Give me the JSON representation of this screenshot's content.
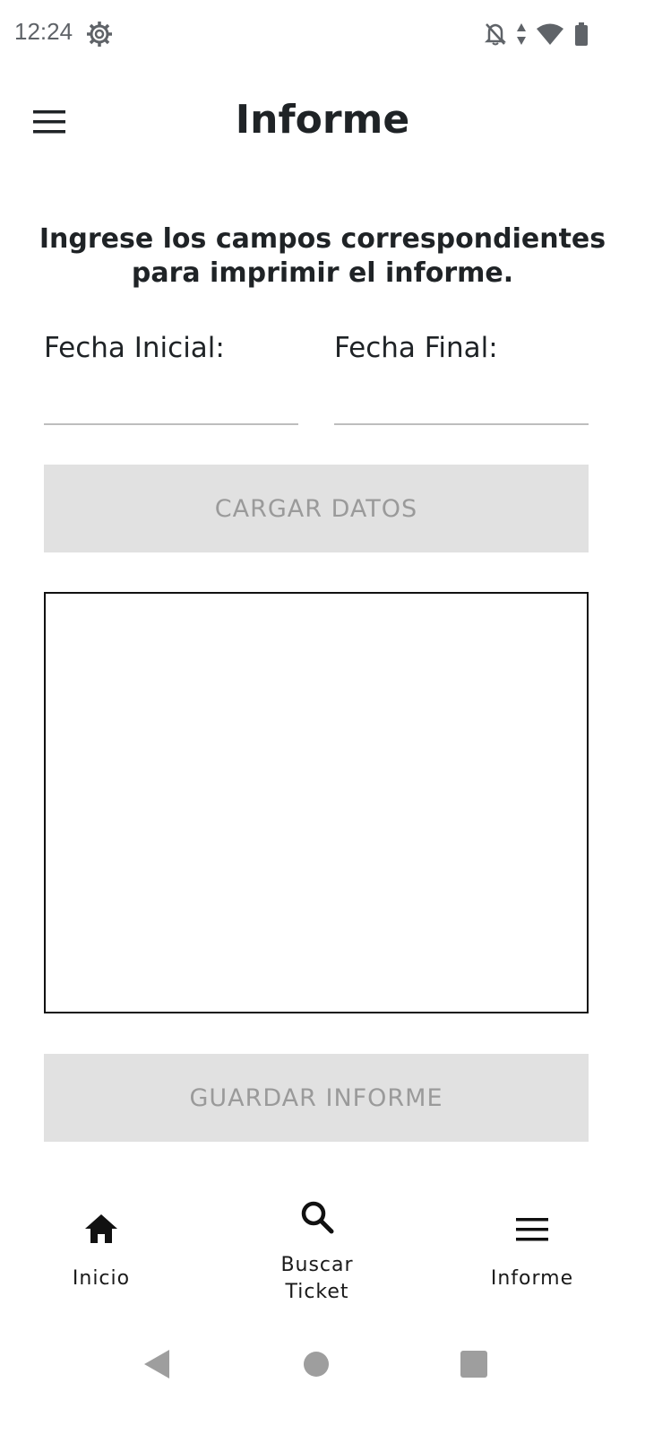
{
  "status_bar": {
    "time": "12:24",
    "icons": [
      "settings-gear-icon",
      "notifications-off-icon",
      "data-arrows-icon",
      "wifi-icon",
      "battery-icon"
    ]
  },
  "app_bar": {
    "title": "Informe",
    "menu_icon": "hamburger-menu-icon"
  },
  "form": {
    "instructions": "Ingrese los campos correspondientes para imprimir el informe.",
    "start_date_label": "Fecha Inicial:",
    "start_date_value": "",
    "end_date_label": "Fecha Final:",
    "end_date_value": "",
    "load_button": "CARGAR DATOS",
    "report_content": "",
    "save_button": "GUARDAR INFORME"
  },
  "bottom_nav": {
    "items": [
      {
        "label": "Inicio",
        "icon": "home-icon"
      },
      {
        "label": "Buscar Ticket",
        "icon": "search-icon"
      },
      {
        "label": "Informe",
        "icon": "menu-icon"
      }
    ]
  },
  "system_nav": {
    "buttons": [
      "back-icon",
      "home-circle-icon",
      "recents-icon"
    ]
  },
  "colors": {
    "text": "#1f2326",
    "button_bg": "#e1e1e1",
    "button_text": "#9a9a9a",
    "system_nav": "#9e9e9e"
  }
}
